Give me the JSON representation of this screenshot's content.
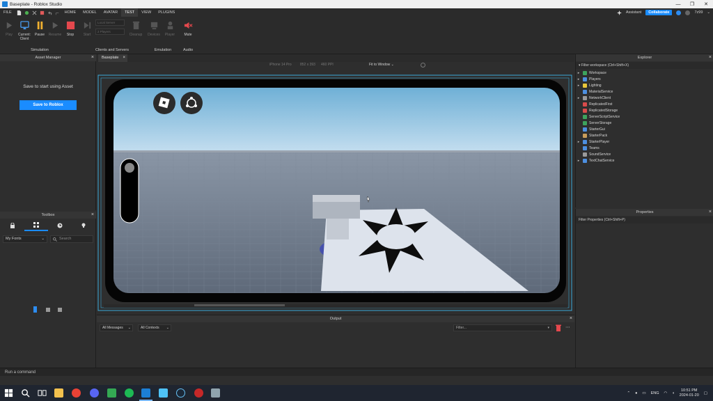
{
  "window": {
    "title": "Baseplate - Roblox Studio",
    "min": "—",
    "max": "❐",
    "close": "✕"
  },
  "menu": {
    "items": [
      "FILE",
      "HOME",
      "MODEL",
      "AVATAR",
      "TEST",
      "VIEW",
      "PLUGINS"
    ],
    "active": "TEST",
    "assistant": "Assistant",
    "collaborate": "Collaborate",
    "user": "7z99"
  },
  "ribbon": {
    "play": "Play",
    "current_client": "Current:\nClient",
    "pause": "Pause",
    "resume": "Resume",
    "stop": "Stop",
    "start": "Start",
    "local_server": "Local Server",
    "players": "2 Players",
    "cleanup": "Cleanup",
    "devices": "Devices",
    "player": "Player",
    "mute": "Mute",
    "groups": {
      "simulation": "Simulation",
      "clients": "Clients and Servers",
      "emulation": "Emulation",
      "audio": "Audio"
    }
  },
  "asset_manager": {
    "title": "Asset Manager",
    "hint": "Save to start using Asset",
    "button": "Save to Roblox"
  },
  "toolbox": {
    "title": "Toolbox",
    "dropdown": "My Fonts",
    "search_placeholder": "Search"
  },
  "viewport": {
    "tab": "Baseplate",
    "device": "iPhone 14 Pro",
    "resolution": "852 x 393",
    "dpi": "460 PPI",
    "fit": "Fit to Window"
  },
  "output": {
    "title": "Output",
    "messages_filter": "All Messages",
    "contexts_filter": "All Contexts",
    "filter_placeholder": "Filter..."
  },
  "explorer": {
    "title": "Explorer",
    "filter": "Filter workspace (Ctrl+Shift+X)",
    "items": [
      {
        "label": "Workspace",
        "expandable": true,
        "color": "#3da35d"
      },
      {
        "label": "Players",
        "expandable": true,
        "color": "#4d8fe0"
      },
      {
        "label": "Lighting",
        "expandable": true,
        "color": "#e8c63a"
      },
      {
        "label": "MaterialService",
        "expandable": false,
        "color": "#4d8fe0"
      },
      {
        "label": "NetworkClient",
        "expandable": true,
        "color": "#9a9a9a"
      },
      {
        "label": "ReplicatedFirst",
        "expandable": false,
        "color": "#d94b4b"
      },
      {
        "label": "ReplicatedStorage",
        "expandable": false,
        "color": "#d94b4b"
      },
      {
        "label": "ServerScriptService",
        "expandable": false,
        "color": "#3da35d"
      },
      {
        "label": "ServerStorage",
        "expandable": false,
        "color": "#3da35d"
      },
      {
        "label": "StarterGui",
        "expandable": false,
        "color": "#4d8fe0"
      },
      {
        "label": "StarterPack",
        "expandable": false,
        "color": "#c99d5a"
      },
      {
        "label": "StarterPlayer",
        "expandable": true,
        "color": "#4d8fe0"
      },
      {
        "label": "Teams",
        "expandable": false,
        "color": "#4d8fe0"
      },
      {
        "label": "SoundService",
        "expandable": false,
        "color": "#9a9a9a"
      },
      {
        "label": "TextChatService",
        "expandable": true,
        "color": "#4d8fe0"
      }
    ]
  },
  "properties": {
    "title": "Properties",
    "filter": "Filter Properties (Ctrl+Shift+P)"
  },
  "command_bar": {
    "placeholder": "Run a command"
  },
  "taskbar": {
    "lang": "ENG",
    "time": "10:51 PM",
    "date": "2024-01-20"
  }
}
